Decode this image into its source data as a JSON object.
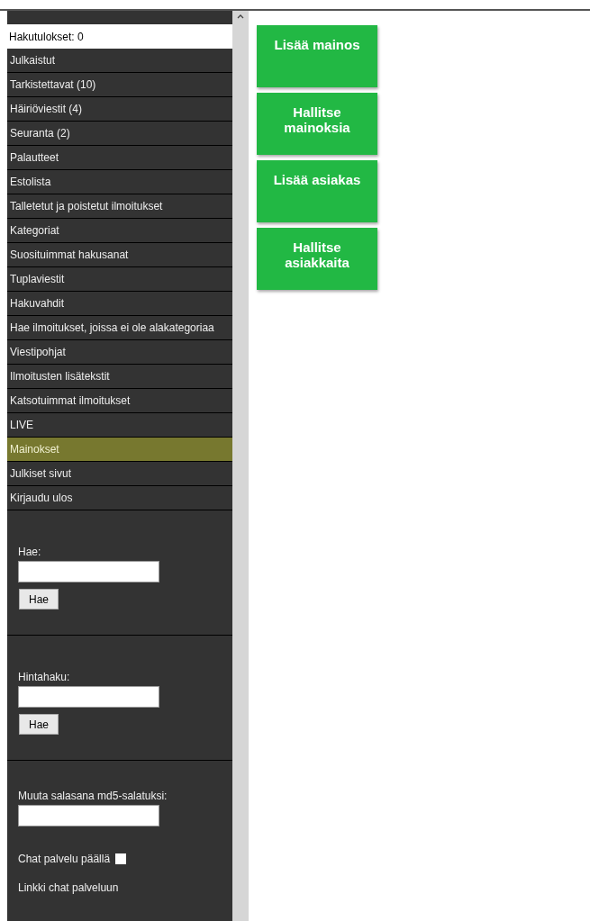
{
  "results": "Hakutulokset: 0",
  "menu": [
    {
      "label": "Julkaistut",
      "selected": false
    },
    {
      "label": "Tarkistettavat (10)",
      "selected": false
    },
    {
      "label": "Häiriöviestit (4)",
      "selected": false
    },
    {
      "label": "Seuranta (2)",
      "selected": false
    },
    {
      "label": "Palautteet",
      "selected": false
    },
    {
      "label": "Estolista",
      "selected": false
    },
    {
      "label": "Talletetut ja poistetut ilmoitukset",
      "selected": false
    },
    {
      "label": "Kategoriat",
      "selected": false
    },
    {
      "label": "Suosituimmat hakusanat",
      "selected": false
    },
    {
      "label": "Tuplaviestit",
      "selected": false
    },
    {
      "label": "Hakuvahdit",
      "selected": false
    },
    {
      "label": "Hae ilmoitukset, joissa ei ole alakategoriaa",
      "selected": false
    },
    {
      "label": "Viestipohjat",
      "selected": false
    },
    {
      "label": "Ilmoitusten lisätekstit",
      "selected": false
    },
    {
      "label": "Katsotuimmat ilmoitukset",
      "selected": false
    },
    {
      "label": "LIVE",
      "selected": false
    },
    {
      "label": "Mainokset",
      "selected": true
    },
    {
      "label": "Julkiset sivut",
      "selected": false
    },
    {
      "label": "Kirjaudu ulos",
      "selected": false
    }
  ],
  "search_forms": [
    {
      "label": "Hae:",
      "button": "Hae"
    },
    {
      "label": "Hintahaku:",
      "button": "Hae"
    }
  ],
  "password": {
    "label": "Muuta salasana md5-salatuksi:"
  },
  "chat": {
    "label": "Chat palvelu päällä",
    "checked": false
  },
  "chat_link": "Linkki chat palveluun",
  "actions": [
    "Lisää mainos",
    "Hallitse mainoksia",
    "Lisää asiakas",
    "Hallitse asiakkaita"
  ]
}
